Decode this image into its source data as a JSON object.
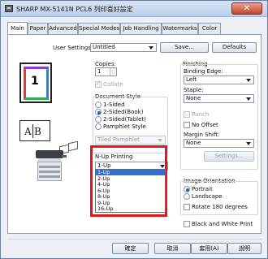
{
  "window": {
    "title": "SHARP MX-5141N PCL6 列印喜好設定",
    "close_glyph": "✕"
  },
  "tabs": [
    {
      "label": "Main",
      "active": true
    },
    {
      "label": "Paper",
      "active": false
    },
    {
      "label": "Advanced",
      "active": false
    },
    {
      "label": "Special Modes",
      "active": false
    },
    {
      "label": "Job Handling",
      "active": false
    },
    {
      "label": "Watermarks",
      "active": false
    },
    {
      "label": "Color",
      "active": false
    }
  ],
  "user_settings": {
    "label": "User Settings:",
    "value": "Untitled",
    "save_label": "Save...",
    "defaults_label": "Defaults"
  },
  "preview": {
    "page_number": "1",
    "letter_a": "A",
    "letter_b": "B",
    "binding_marker": "|"
  },
  "copies": {
    "label": "Copies:",
    "value": "1",
    "collate_label": "Collate",
    "collate_checked": true,
    "collate_disabled": true
  },
  "document_style": {
    "label": "Document Style",
    "options": [
      {
        "label": "1-Sided",
        "selected": false
      },
      {
        "label": "2-Sided(Book)",
        "selected": true
      },
      {
        "label": "2-Sided(Tablet)",
        "selected": false
      },
      {
        "label": "Pamphlet Style",
        "selected": false
      }
    ],
    "pamphlet_value": "Tiled Pamphlet"
  },
  "nup": {
    "label": "N-Up Printing",
    "value": "1-Up",
    "options": [
      "1-Up",
      "2-Up",
      "4-Up",
      "6-Up",
      "8-Up",
      "9-Up",
      "16-Up"
    ],
    "highlighted": "1-Up"
  },
  "finishing": {
    "label": "Finishing",
    "binding_edge_label": "Binding Edge:",
    "binding_edge_value": "Left",
    "staple_label": "Staple:",
    "staple_value": "None",
    "punch_label": "Punch",
    "no_offset_label": "No Offset",
    "margin_shift_label": "Margin Shift:",
    "margin_shift_value": "None",
    "settings_label": "Settings..."
  },
  "orientation": {
    "label": "Image Orientation",
    "options": [
      {
        "label": "Portrait",
        "selected": true
      },
      {
        "label": "Landscape",
        "selected": false
      }
    ],
    "rotate_label": "Rotate 180 degrees"
  },
  "bw_print_label": "Black and White Print",
  "buttons": {
    "ok": "確定",
    "cancel": "取消",
    "apply": "套用(A)",
    "help": "說明"
  },
  "colors": {
    "highlight_border": "#e3161b",
    "selection": "#2f6fd6",
    "close_button": "#c6442c"
  }
}
